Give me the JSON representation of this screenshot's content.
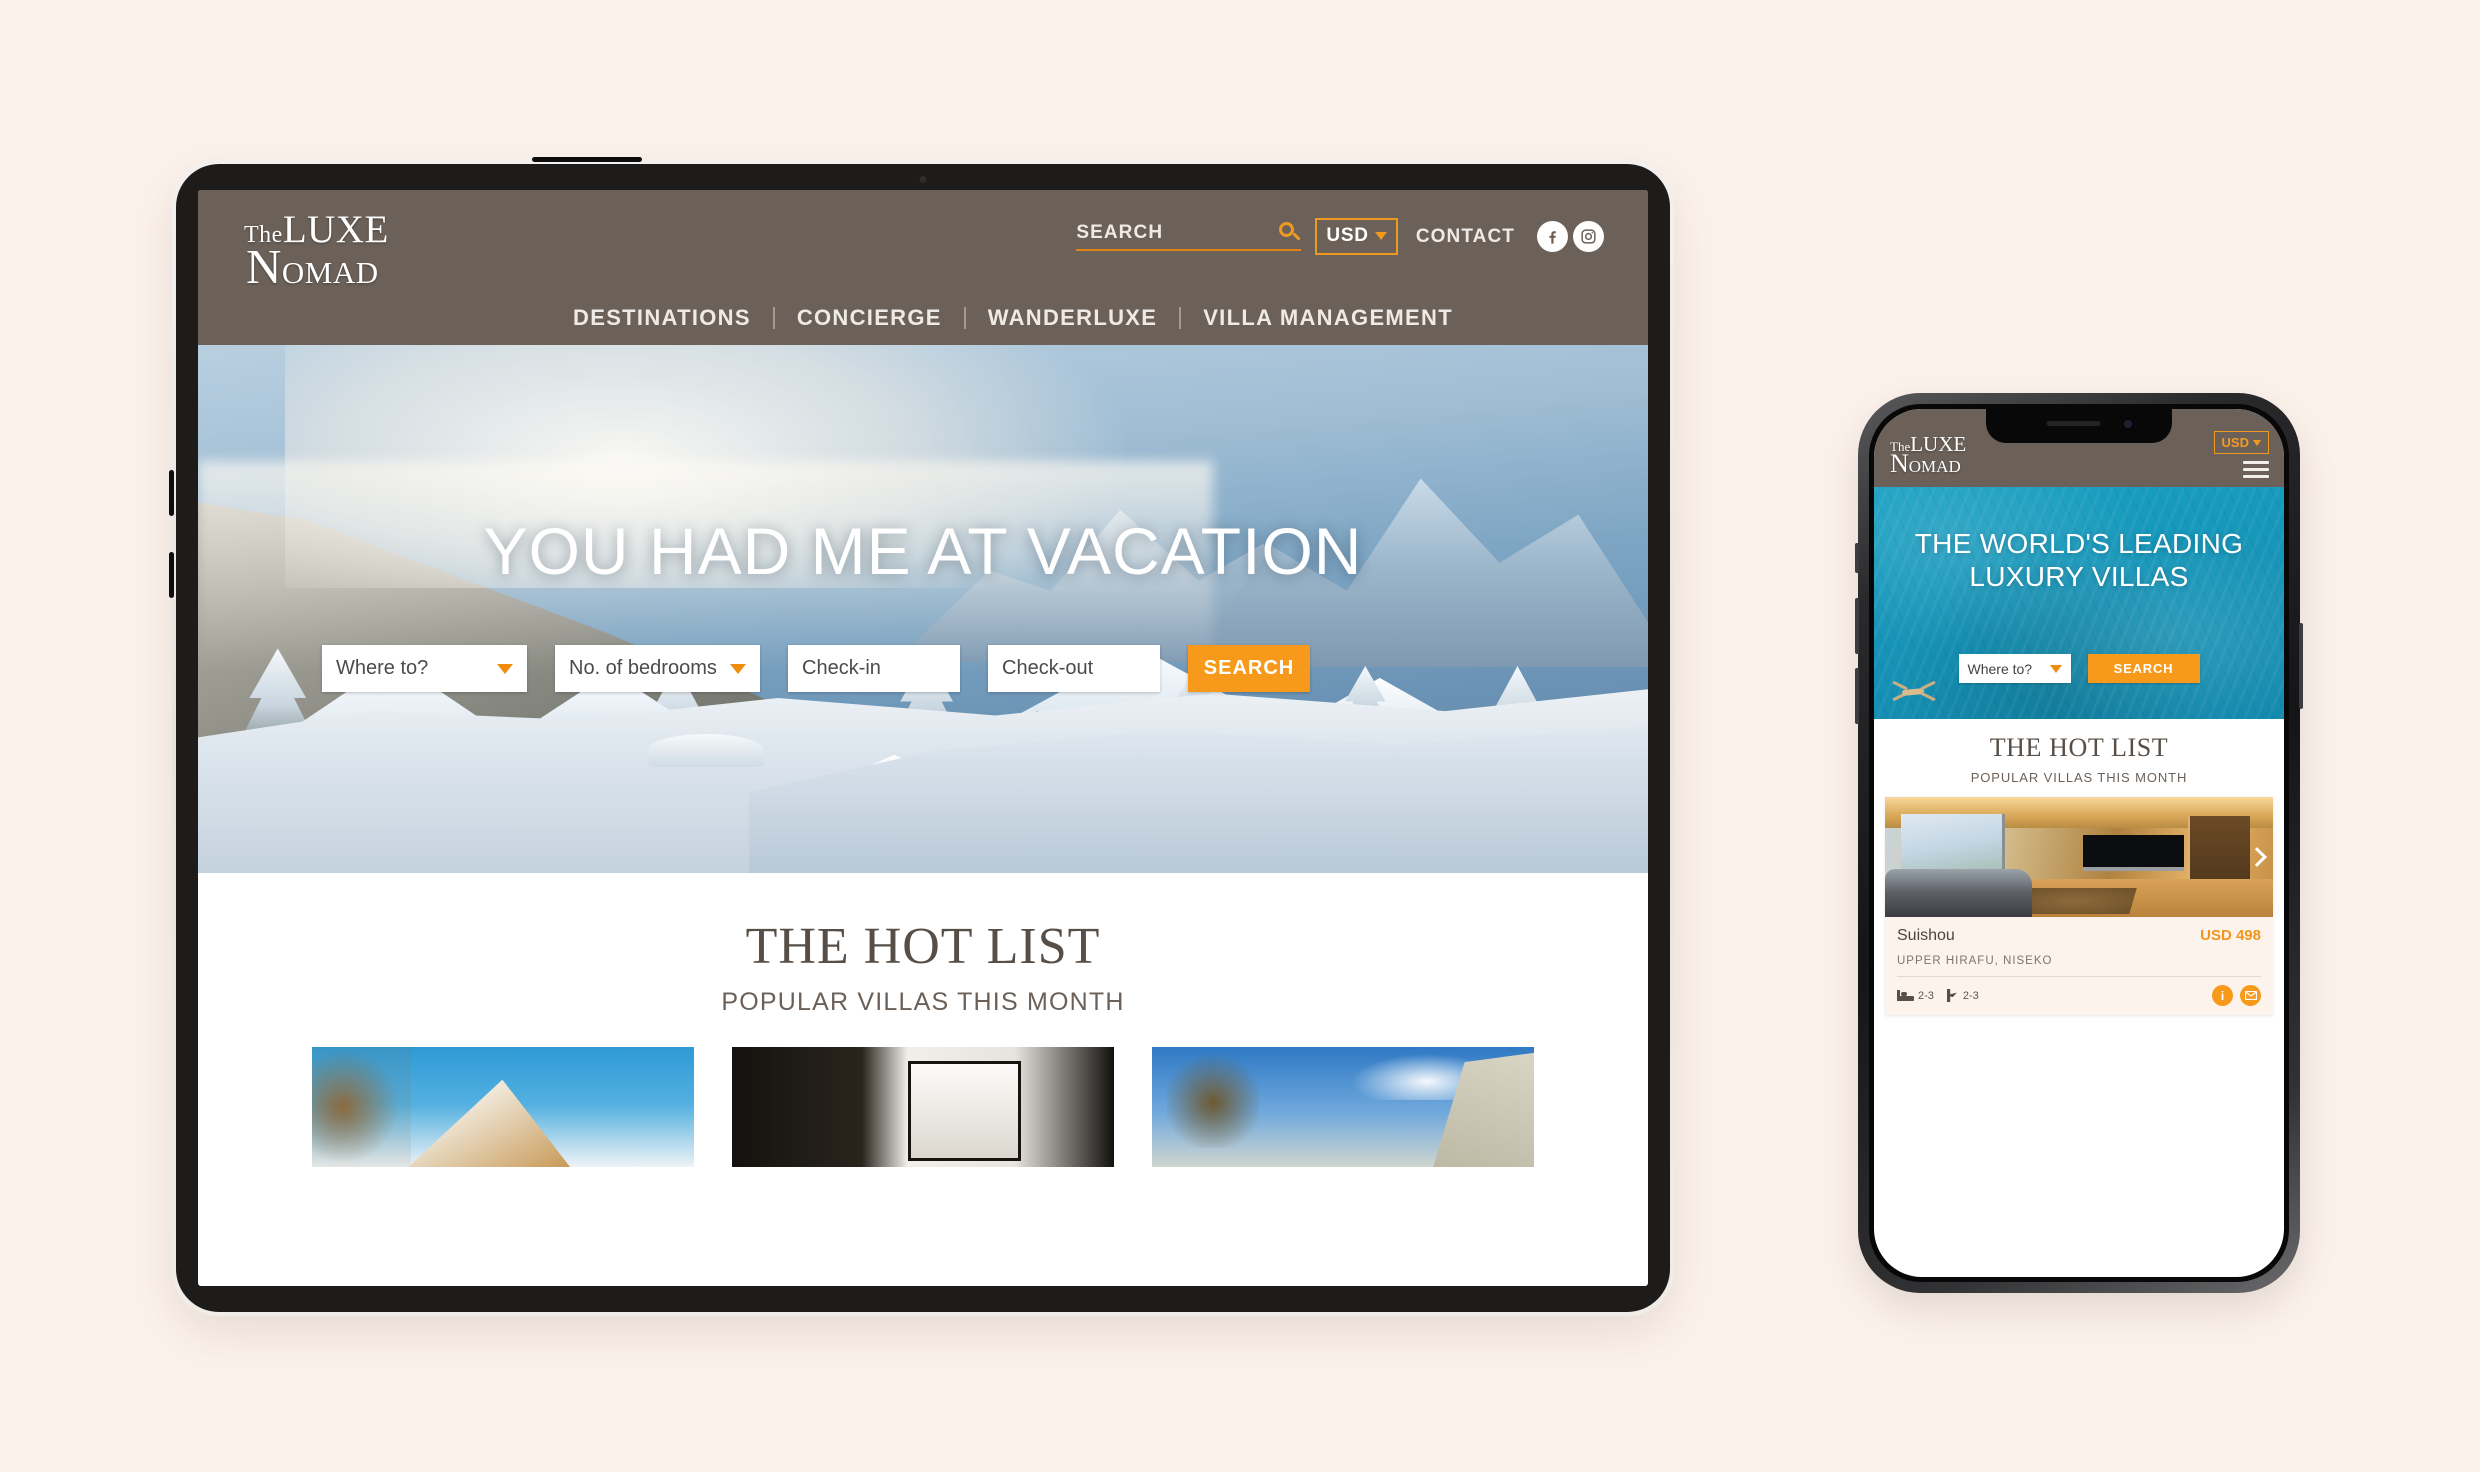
{
  "page": {
    "background_color": "#fcf2ec",
    "accent_color": "#f79a1b",
    "brand_bar_color": "#6b6159"
  },
  "brand": {
    "line1_small": "The",
    "line1_main": "LUXE",
    "line2_first": "N",
    "line2_rest": "OMAD",
    "full": "The Luxe Nomad"
  },
  "tablet": {
    "header": {
      "search_label": "SEARCH",
      "search_icon": "search-icon",
      "currency": "USD",
      "currency_caret": "chevron-down-icon",
      "contact_label": "CONTACT",
      "social": [
        {
          "name": "facebook-icon",
          "glyph": "f"
        },
        {
          "name": "instagram-icon",
          "glyph": "instagram"
        }
      ],
      "nav": [
        {
          "label": "DESTINATIONS"
        },
        {
          "label": "CONCIERGE"
        },
        {
          "label": "WANDERLUXE"
        },
        {
          "label": "VILLA MANAGEMENT"
        }
      ]
    },
    "hero": {
      "title": "YOU HAD ME AT VACATION",
      "image_description": "snow-covered alpine village with misty mountains"
    },
    "search_form": {
      "where": "Where to?",
      "bedrooms": "No. of bedrooms",
      "checkin": "Check-in",
      "checkout": "Check-out",
      "search_button": "SEARCH"
    },
    "hot_list": {
      "title": "THE HOT LIST",
      "subtitle": "POPULAR VILLAS THIS MONTH",
      "cards": [
        {
          "image_description": "chalet roof against blue sky with bare trees"
        },
        {
          "image_description": "dark timber interior with bright window"
        },
        {
          "image_description": "palm tree against blue sky beside stone wall"
        }
      ]
    }
  },
  "phone": {
    "header": {
      "currency": "USD",
      "currency_caret": "chevron-down-icon",
      "menu_icon": "hamburger-menu-icon"
    },
    "hero": {
      "title": "THE WORLD'S LEADING LUXURY VILLAS",
      "image_description": "turquoise pool water with swimmer"
    },
    "search_form": {
      "where": "Where to?",
      "search_button": "SEARCH"
    },
    "hot_list": {
      "title": "THE HOT LIST",
      "subtitle": "POPULAR VILLAS THIS MONTH"
    },
    "villa_card": {
      "image_description": "warm-lit modern living room with TV and panoramic window",
      "next_arrow": "chevron-right-icon",
      "name": "Suishou",
      "price": "USD 498",
      "location": "UPPER HIRAFU, NISEKO",
      "bedrooms": "2-3",
      "guests": "2-3",
      "bed_icon": "bed-icon",
      "guest_icon": "person-icon",
      "info_button": "info-icon",
      "enquire_button": "mail-icon"
    }
  }
}
